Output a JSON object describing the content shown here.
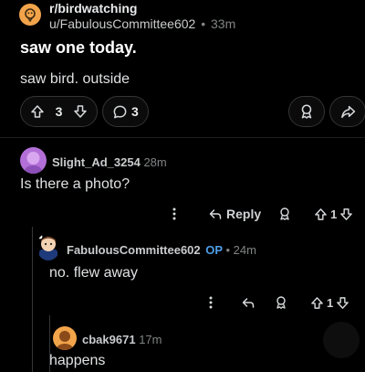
{
  "post": {
    "subreddit": "r/birdwatching",
    "author": "u/FabulousCommittee602",
    "separator": "•",
    "age": "33m",
    "title": "saw one today.",
    "body": "saw bird. outside",
    "score": "3",
    "comments": "3"
  },
  "comments": [
    {
      "user": "Slight_Ad_3254",
      "age": "28m",
      "body": "Is there a photo?",
      "reply_label": "Reply",
      "score": "1"
    },
    {
      "user": "FabulousCommittee602",
      "op_tag": "OP",
      "separator": "•",
      "age": "24m",
      "body": "no. flew away",
      "score": "1"
    },
    {
      "user": "cbak9671",
      "age": "17m",
      "body": "happens"
    }
  ],
  "colors": {
    "background": "#000000",
    "op_tag": "#4f9ee8",
    "subreddit_icon": "#f2a44b",
    "avatar_purple": "#b36fd8"
  },
  "icons": {
    "upvote": "arrow-up-outline",
    "downvote": "arrow-down-outline",
    "comment": "speech-bubble",
    "award": "ribbon-award",
    "share": "share-arrow",
    "more": "vertical-ellipsis",
    "reply": "reply-arrow"
  }
}
